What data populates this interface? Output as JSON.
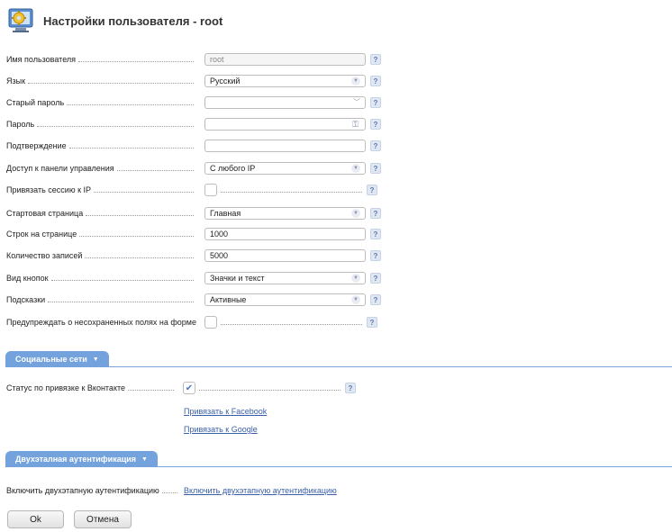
{
  "header": {
    "title": "Настройки пользователя - root",
    "icon": "gear-monitor-icon"
  },
  "fields": [
    {
      "id": "username",
      "label": "Имя пользователя",
      "type": "text",
      "value": "root",
      "disabled": true
    },
    {
      "id": "language",
      "label": "Язык",
      "type": "select",
      "value": "Русский"
    },
    {
      "id": "old-password",
      "label": "Старый пароль",
      "type": "select-thin",
      "value": ""
    },
    {
      "id": "password",
      "label": "Пароль",
      "type": "password",
      "value": ""
    },
    {
      "id": "confirm",
      "label": "Подтверждение",
      "type": "text",
      "value": ""
    },
    {
      "id": "panel-access",
      "label": "Доступ к панели управления",
      "type": "select",
      "value": "С любого IP"
    },
    {
      "id": "bind-session-ip",
      "label": "Привязать сессию к IP",
      "type": "checkbox",
      "checked": false
    },
    {
      "id": "start-page",
      "label": "Стартовая страница",
      "type": "select",
      "value": "Главная"
    },
    {
      "id": "rows-per-page",
      "label": "Строк на странице",
      "type": "text",
      "value": "1000"
    },
    {
      "id": "records-count",
      "label": "Количество записей",
      "type": "text",
      "value": "5000"
    },
    {
      "id": "button-view",
      "label": "Вид кнопок",
      "type": "select",
      "value": "Значки и текст"
    },
    {
      "id": "hints",
      "label": "Подсказки",
      "type": "select",
      "value": "Активные"
    },
    {
      "id": "warn-unsaved",
      "label": "Предупреждать о несохраненных полях на форме",
      "type": "checkbox",
      "checked": false
    }
  ],
  "help_label": "?",
  "social": {
    "title": "Социальные сети",
    "vk_label": "Статус по привязке к Вконтакте",
    "vk_checked": true,
    "facebook_link": "Привязать к Facebook",
    "google_link": "Привязать к Google"
  },
  "twofa": {
    "title": "Двухэталная аутентификация",
    "label": "Включить двухэтапную аутентификацию",
    "link": "Включить двухэтапную аутентификацию"
  },
  "buttons": {
    "ok": "Ok",
    "cancel": "Отмена"
  },
  "colors": {
    "accent": "#73a2dc",
    "link": "#3a5fa8"
  }
}
